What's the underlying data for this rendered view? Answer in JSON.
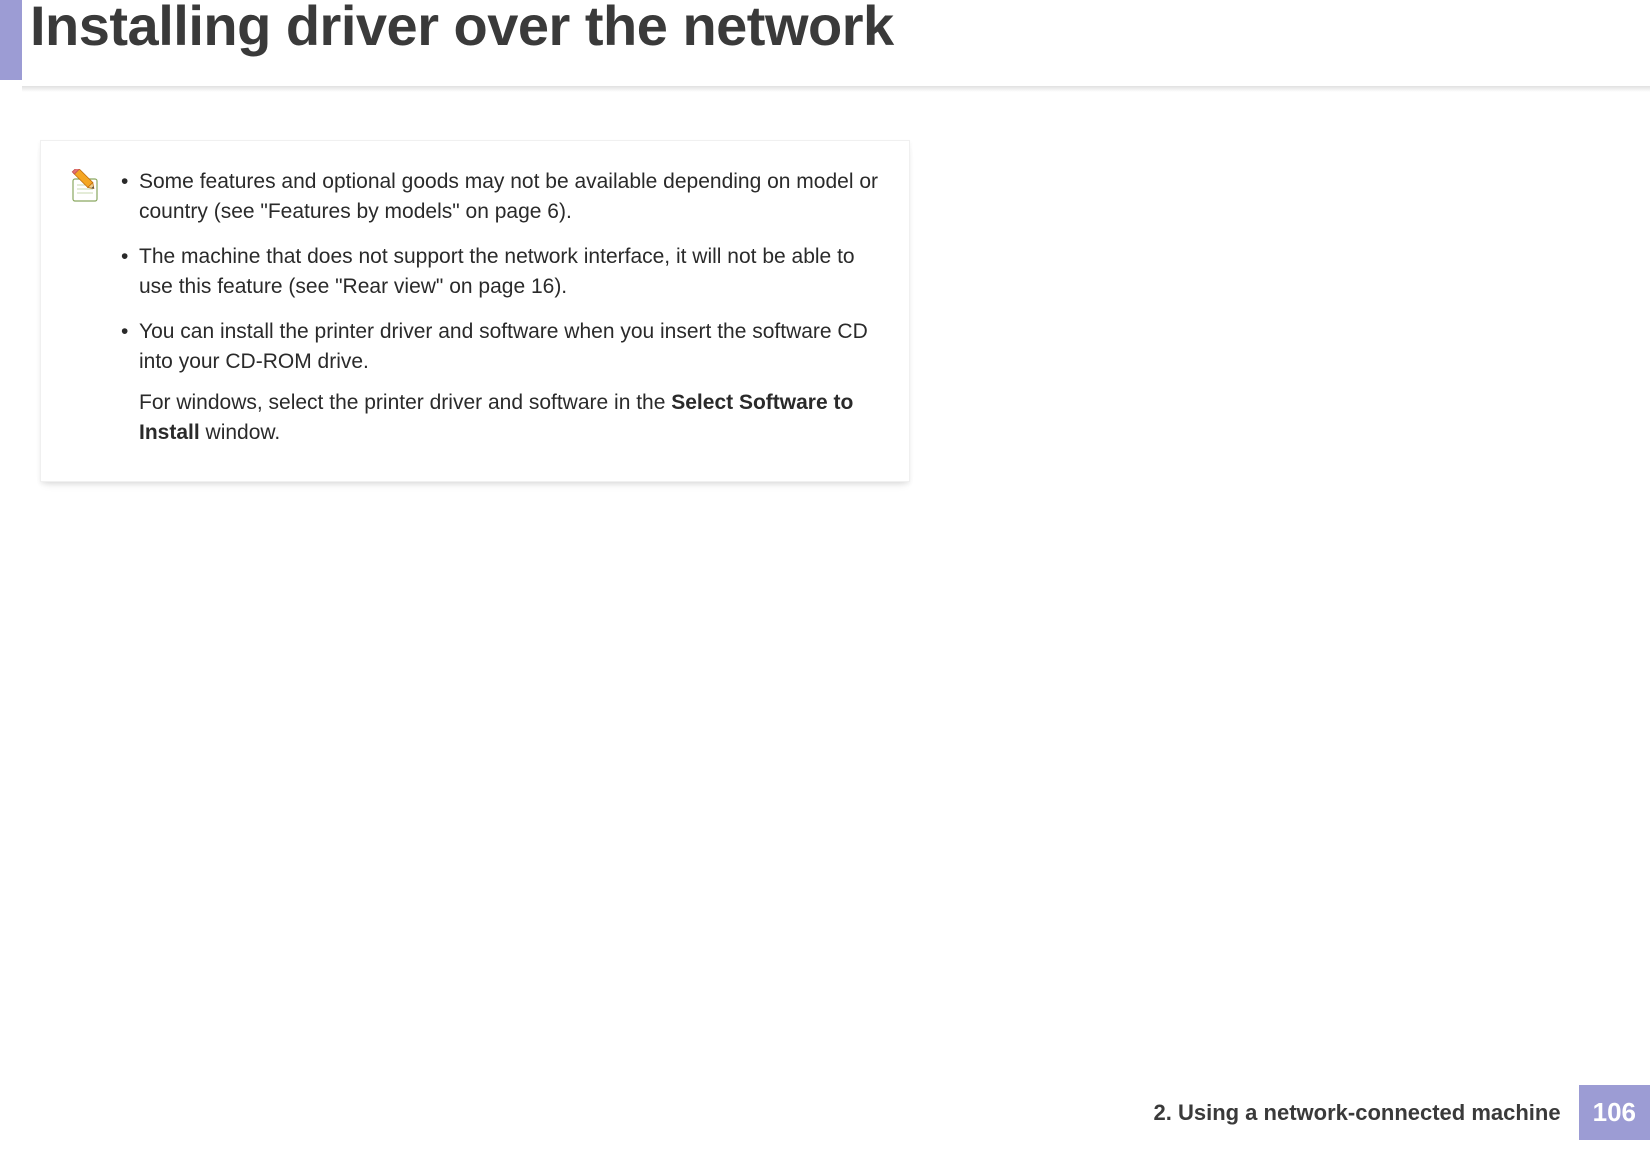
{
  "header": {
    "title": "Installing driver over the network"
  },
  "note": {
    "bullets": [
      {
        "text": "Some features and optional goods may not be available depending on model or country (see \"Features by models\" on page 6)."
      },
      {
        "text": "The machine that does not support the network interface, it will not be able to use this feature (see \"Rear view\" on page 16)."
      },
      {
        "text": "You can install the printer driver and software when you insert the software CD into your CD-ROM drive.",
        "sub_prefix": "For windows, select the printer driver and software in the ",
        "sub_bold": "Select Software to Install",
        "sub_suffix": " window."
      }
    ]
  },
  "footer": {
    "chapter": "2.  Using a network-connected machine",
    "page": "106"
  }
}
